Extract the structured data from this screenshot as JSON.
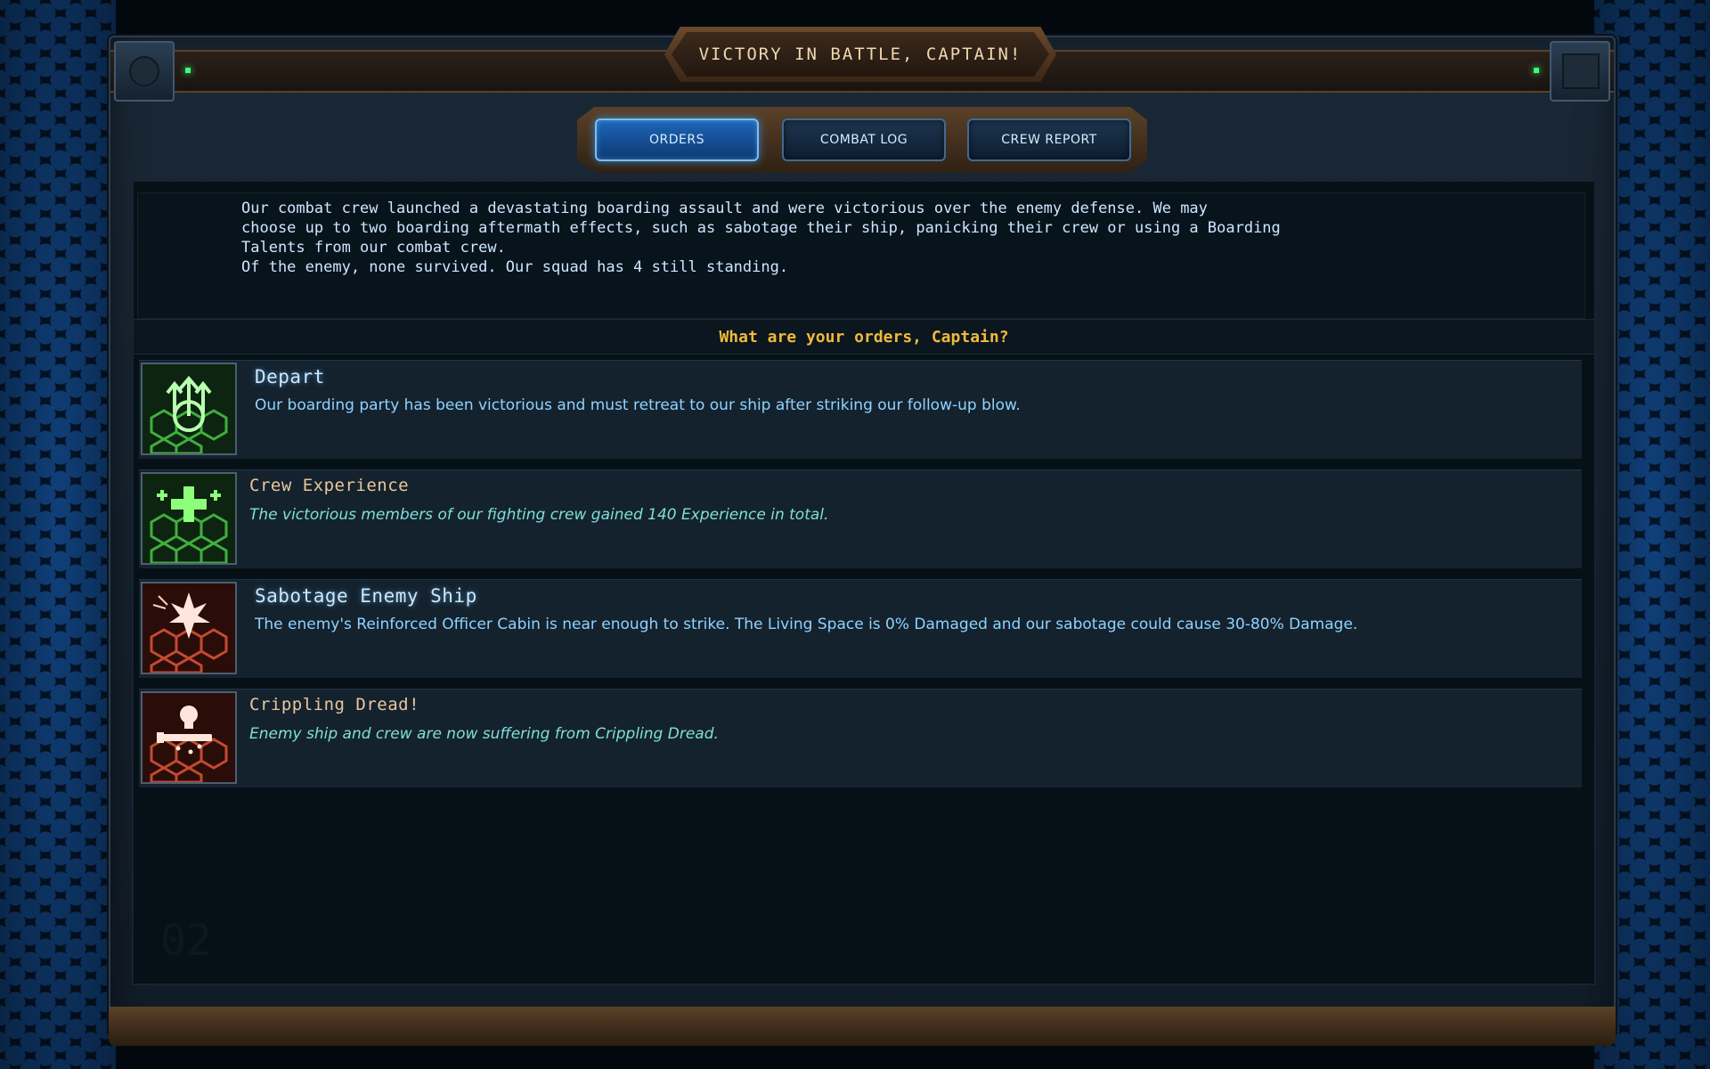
{
  "title": "VICTORY IN BATTLE, CAPTAIN!",
  "tabs": [
    {
      "label": "ORDERS",
      "active": true
    },
    {
      "label": "COMBAT LOG",
      "active": false
    },
    {
      "label": "CREW REPORT",
      "active": false
    }
  ],
  "narrative": {
    "line1": "Our combat crew launched a devastating boarding assault and were victorious over the enemy defense. We may",
    "line2": "choose up to two boarding aftermath effects, such as sabotage their ship, panicking their crew or using a Boarding",
    "line3": "Talents from our combat crew.",
    "line4": "Of the enemy, none survived. Our squad has 4 still standing."
  },
  "prompt": "What are your orders, Captain?",
  "options": [
    {
      "title": "Depart",
      "description": "Our boarding party has been victorious and must retreat to our ship after striking our follow-up blow.",
      "icon": "depart-icon"
    },
    {
      "title": "Crew Experience",
      "description": "The victorious members of our fighting crew gained 140 Experience in total.",
      "icon": "crew-experience-icon"
    },
    {
      "title": "Sabotage Enemy Ship",
      "description": "The enemy's Reinforced Officer Cabin is near enough to strike. The Living Space is 0% Damaged and our sabotage could cause 30-80% Damage.",
      "icon": "sabotage-icon"
    },
    {
      "title": "Crippling Dread!",
      "description": "Enemy ship and crew are now suffering from Crippling Dread.",
      "icon": "crippling-dread-icon"
    }
  ],
  "colors": {
    "accent_blue": "#1e66b8",
    "gold_text": "#f0b93c",
    "frame_bronze": "#5b4128",
    "option_blue_text": "#8fd2ff",
    "option_italic_text": "#7fe0d8"
  }
}
